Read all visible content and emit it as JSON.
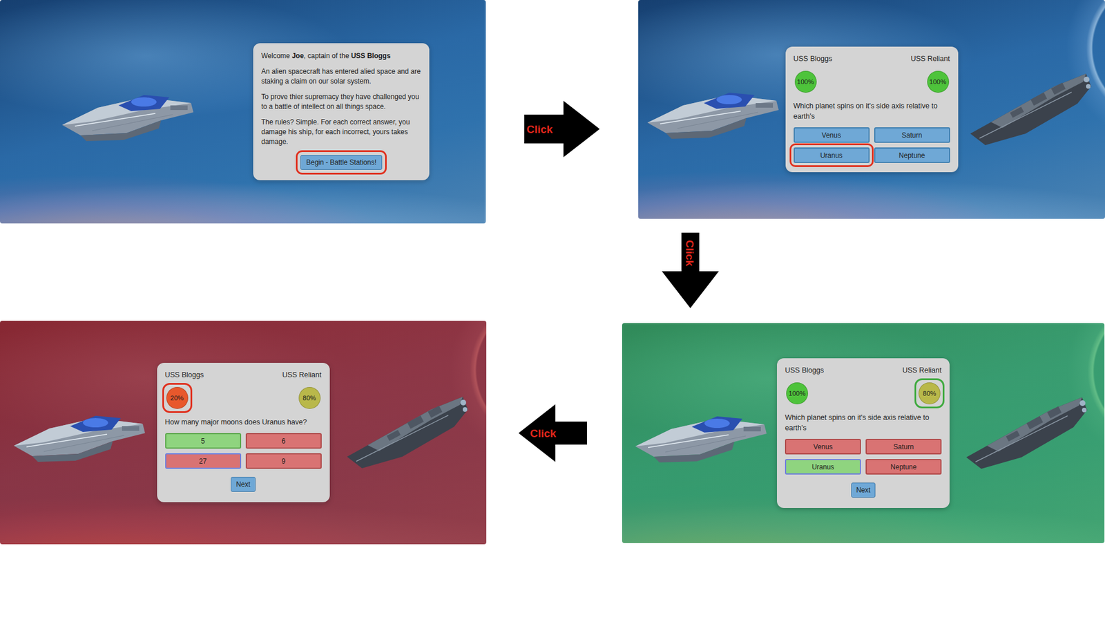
{
  "screens": [
    {
      "kind": "intro",
      "outcome": "none",
      "highlight_color": "#e0301e",
      "greeting": [
        {
          "text": "Welcome ",
          "bold": false
        },
        {
          "text": "Joe",
          "bold": true
        },
        {
          "text": ", captain of the ",
          "bold": false
        },
        {
          "text": "USS Bloggs",
          "bold": true
        }
      ],
      "paragraphs": [
        "An alien spacecraft has entered alied space and are staking a claim on our solar system.",
        "To prove thier supremacy they have challenged you to a battle of intellect on all things space.",
        "The rules? Simple. For each correct answer, you damage his ship, for each incorrect, yours takes damage."
      ],
      "button": {
        "label": "Begin - Battle Stations!",
        "highlighted": true
      }
    },
    {
      "kind": "question",
      "outcome": "none",
      "highlight_color": "#e0301e",
      "ships": [
        {
          "name": "USS Bloggs",
          "health": "100%",
          "color": "#4ec33b",
          "highlighted": false
        },
        {
          "name": "USS Reliant",
          "health": "100%",
          "color": "#4ec33b",
          "highlighted": false
        }
      ],
      "question": "Which planet spins on it's side axis relative to earth's",
      "answers": [
        {
          "label": "Venus",
          "result": "none",
          "selected": false,
          "highlighted": false
        },
        {
          "label": "Saturn",
          "result": "none",
          "selected": false,
          "highlighted": false
        },
        {
          "label": "Uranus",
          "result": "none",
          "selected": false,
          "highlighted": true
        },
        {
          "label": "Neptune",
          "result": "none",
          "selected": false,
          "highlighted": false
        }
      ]
    },
    {
      "kind": "question",
      "outcome": "correct",
      "highlight_color": "#3faa3f",
      "ships": [
        {
          "name": "USS Bloggs",
          "health": "100%",
          "color": "#4ec33b",
          "highlighted": false
        },
        {
          "name": "USS Reliant",
          "health": "80%",
          "color": "#b9b84a",
          "highlighted": true
        }
      ],
      "question": "Which planet spins on it's side axis relative to earth's",
      "answers": [
        {
          "label": "Venus",
          "result": "wrong",
          "selected": false,
          "highlighted": false
        },
        {
          "label": "Saturn",
          "result": "wrong",
          "selected": false,
          "highlighted": false
        },
        {
          "label": "Uranus",
          "result": "correct",
          "selected": true,
          "highlighted": false
        },
        {
          "label": "Neptune",
          "result": "wrong",
          "selected": false,
          "highlighted": false
        }
      ],
      "next_button": "Next"
    },
    {
      "kind": "question",
      "outcome": "wrong",
      "highlight_color": "#e0301e",
      "ships": [
        {
          "name": "USS Bloggs",
          "health": "20%",
          "color": "#e8582c",
          "highlighted": true
        },
        {
          "name": "USS Reliant",
          "health": "80%",
          "color": "#b9b84a",
          "highlighted": false
        }
      ],
      "question": "How many major moons does Uranus have?",
      "answers": [
        {
          "label": "5",
          "result": "correct",
          "selected": false,
          "highlighted": false
        },
        {
          "label": "6",
          "result": "wrong",
          "selected": false,
          "highlighted": false
        },
        {
          "label": "27",
          "result": "wrong",
          "selected": true,
          "highlighted": false
        },
        {
          "label": "9",
          "result": "wrong",
          "selected": false,
          "highlighted": false
        }
      ],
      "next_button": "Next"
    }
  ],
  "arrows": [
    {
      "label": "Click",
      "direction": "right"
    },
    {
      "label": "Click",
      "direction": "down"
    },
    {
      "label": "Click",
      "direction": "left"
    }
  ]
}
